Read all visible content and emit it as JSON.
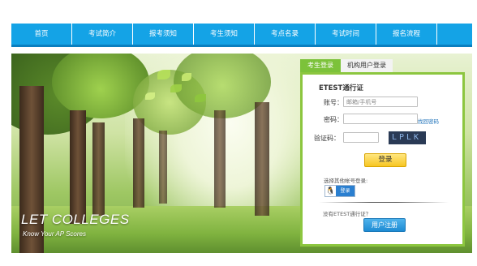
{
  "nav": {
    "items": [
      "首页",
      "考试简介",
      "报考须知",
      "考生须知",
      "考点名录",
      "考试时间",
      "报名流程"
    ]
  },
  "hero": {
    "slogan": "LET COLLEGES",
    "subtitle": "Know Your AP Scores"
  },
  "login": {
    "tabs": [
      "考生登录",
      "机构用户登录"
    ],
    "active_tab": "考生登录",
    "title": "ETEST通行证",
    "account_label": "账号：",
    "account_placeholder": "邮箱/手机号",
    "password_label": "密码：",
    "forgot_link": "找回密码",
    "captcha_label": "验证码：",
    "captcha_text": "LPLK",
    "login_button": "登录",
    "other_account_label": "选择其他帐号登录:",
    "qq_icon": "qq-penguin-icon",
    "qq_button": "登录",
    "no_account_text": "没有ETEST通行证？",
    "register_button": "用户注册"
  },
  "colors": {
    "nav_bg": "#14a3e6",
    "panel_border": "#8cc63f",
    "login_button": "#f7c623",
    "register_button": "#1d8bd3"
  }
}
